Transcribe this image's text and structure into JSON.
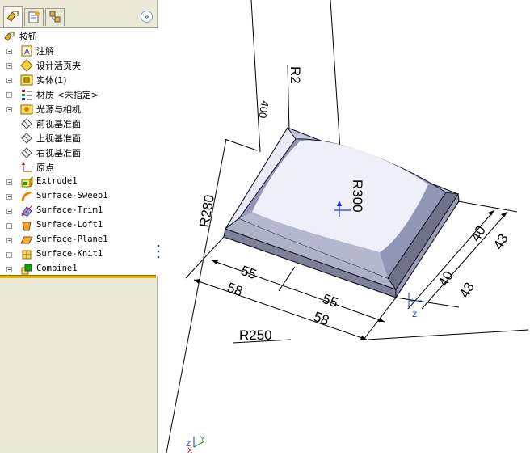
{
  "tree": {
    "root_label": "按钮",
    "items": [
      {
        "label": "注解",
        "icon": "annotation-icon",
        "mono": false
      },
      {
        "label": "设计活页夹",
        "icon": "design-binder-icon",
        "mono": false
      },
      {
        "label": "实体(1)",
        "icon": "solid-bodies-icon",
        "mono": false
      },
      {
        "label": "材质 <未指定>",
        "icon": "material-icon",
        "mono": false
      },
      {
        "label": "光源与相机",
        "icon": "lights-camera-icon",
        "mono": false
      },
      {
        "label": "前视基准面",
        "icon": "plane-icon",
        "mono": false
      },
      {
        "label": "上视基准面",
        "icon": "plane-icon",
        "mono": false
      },
      {
        "label": "右视基准面",
        "icon": "plane-icon",
        "mono": false
      },
      {
        "label": "原点",
        "icon": "origin-icon",
        "mono": false
      },
      {
        "label": "Extrude1",
        "icon": "extrude-icon",
        "mono": true
      },
      {
        "label": "Surface-Sweep1",
        "icon": "surface-sweep-icon",
        "mono": true
      },
      {
        "label": "Surface-Trim1",
        "icon": "surface-trim-icon",
        "mono": true
      },
      {
        "label": "Surface-Loft1",
        "icon": "surface-loft-icon",
        "mono": true
      },
      {
        "label": "Surface-Plane1",
        "icon": "surface-plane-icon",
        "mono": true
      },
      {
        "label": "Surface-Knit1",
        "icon": "surface-knit-icon",
        "mono": true
      },
      {
        "label": "Combine1",
        "icon": "combine-icon",
        "mono": true
      }
    ]
  },
  "panel": {
    "tabs": [
      "feature-manager-tab",
      "property-manager-tab",
      "configuration-manager-tab"
    ],
    "expand_glyph": "»"
  },
  "dimensions": {
    "r2": "R2",
    "r300": "R300",
    "r280": "R280",
    "r250": "R250",
    "d55a": "55",
    "d58a": "58",
    "d55b": "55",
    "d58b": "58",
    "d40a": "40",
    "d43a": "43",
    "d40b": "40",
    "d43b": "43",
    "d400": "400"
  },
  "triad": {
    "x": "X",
    "y": "Y",
    "z": "Z"
  },
  "colors": {
    "panel_bg": "#ece9d8",
    "rollback_bar": "#e8b800",
    "model_face": "#c8ccde",
    "model_edge": "#1a1a2e"
  }
}
